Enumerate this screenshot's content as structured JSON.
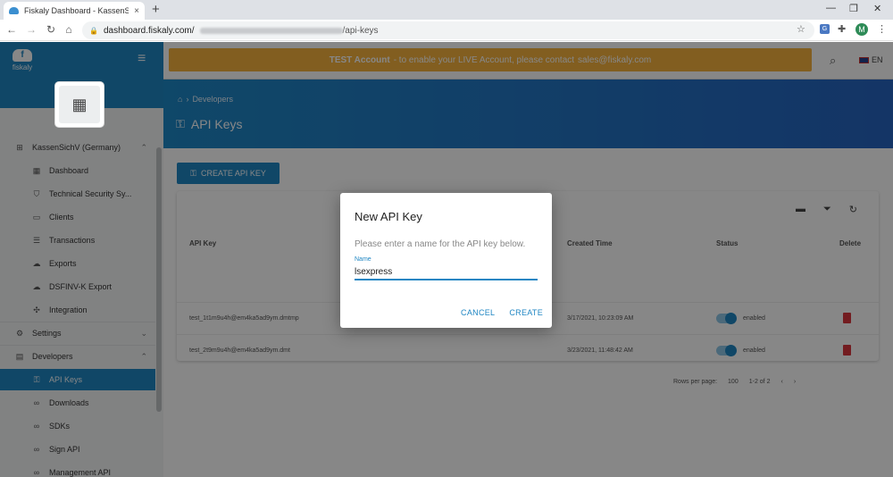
{
  "browser": {
    "tab_title": "Fiskaly Dashboard - KassenSichV",
    "tab_close": "×",
    "new_tab": "+",
    "url_host": "dashboard.fiskaly.com/",
    "url_path": "/api-keys",
    "avatar_letter": "M",
    "win_min": "—",
    "win_restore": "❐",
    "win_close": "✕"
  },
  "sidebar": {
    "logo_text": "fiskaly",
    "groups": [
      {
        "label": "KassenSichV (Germany)",
        "expanded": true
      },
      {
        "label": "Settings",
        "expanded": false
      },
      {
        "label": "Developers",
        "expanded": true
      }
    ],
    "kassen_items": [
      {
        "label": "Dashboard",
        "icon": "grid-icon"
      },
      {
        "label": "Technical Security Sy...",
        "icon": "shield-icon"
      },
      {
        "label": "Clients",
        "icon": "monitor-icon"
      },
      {
        "label": "Transactions",
        "icon": "list-icon"
      },
      {
        "label": "Exports",
        "icon": "cloud-download-icon"
      },
      {
        "label": "DSFINV-K Export",
        "icon": "cloud-download-icon"
      },
      {
        "label": "Integration",
        "icon": "puzzle-icon"
      }
    ],
    "dev_items": [
      {
        "label": "API Keys",
        "icon": "key-icon",
        "active": true
      },
      {
        "label": "Downloads",
        "icon": "link-icon"
      },
      {
        "label": "SDKs",
        "icon": "link-icon"
      },
      {
        "label": "Sign API",
        "icon": "link-icon"
      },
      {
        "label": "Management API",
        "icon": "link-icon"
      }
    ]
  },
  "topbar": {
    "banner_strong": "TEST Account",
    "banner_text": "- to enable your LIVE Account, please contact",
    "banner_email": "sales@fiskaly.com",
    "lang": "EN"
  },
  "hero": {
    "crumb": "Developers",
    "title": "API Keys"
  },
  "main": {
    "create_label": "CREATE API KEY",
    "columns": [
      "API Key",
      "Created Time",
      "Status",
      "Delete"
    ],
    "rows": [
      {
        "key": "test_1t1m9u4h@em4ka5ad9ym.dmtmp",
        "created": "3/17/2021, 10:23:09 AM",
        "status": "enabled"
      },
      {
        "key": "test_2t9m9u4h@em4ka5ad9ym.dmt",
        "created": "3/23/2021, 11:48:42 AM",
        "status": "enabled"
      }
    ],
    "pager": [
      "Rows per page:",
      "100",
      "1-2 of 2",
      "‹",
      "›"
    ]
  },
  "dialog": {
    "title": "New API Key",
    "description": "Please enter a name for the API key below.",
    "field_label": "Name",
    "field_value": "lsexpress",
    "cancel": "CANCEL",
    "create": "CREATE"
  },
  "colors": {
    "brand": "#1f86c3",
    "banner": "#f5b23e",
    "danger": "#d9363e"
  }
}
